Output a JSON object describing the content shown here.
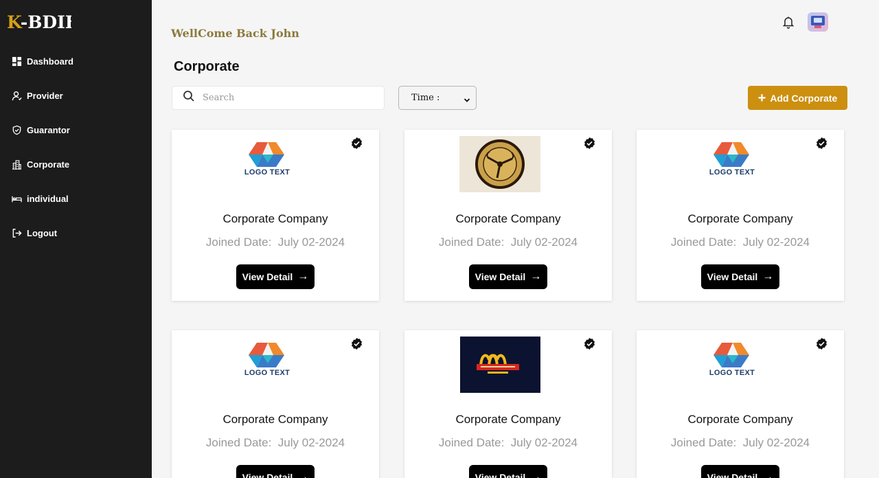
{
  "brand": {
    "k": "K",
    "rest": "-BDIF"
  },
  "sidebar": {
    "items": [
      {
        "label": "Dashboard",
        "icon": "dashboard-icon"
      },
      {
        "label": "Provider",
        "icon": "user-icon"
      },
      {
        "label": "Guarantor",
        "icon": "shield-icon"
      },
      {
        "label": "Corporate",
        "icon": "building-icon"
      },
      {
        "label": "individual",
        "icon": "bed-icon"
      },
      {
        "label": "Logout",
        "icon": "logout-icon"
      }
    ]
  },
  "header": {
    "welcome": "WellCome Back John",
    "bell_icon": "bell-icon",
    "avatar_icon": "avatar-icon"
  },
  "page": {
    "title": "Corporate"
  },
  "toolbar": {
    "search_placeholder": "Search",
    "time_label": "Time :",
    "add_label": "Add Corporate"
  },
  "colors": {
    "sidebar": "#1c1c1c",
    "accent": "#cc8f10",
    "welcome": "#8b7a3e",
    "brand_k": "#d4a017"
  },
  "cards": [
    {
      "name": "Corporate Company",
      "joined_label": "Joined Date:",
      "joined_date": "July 02-2024",
      "button": "View Detail",
      "logo": "logo-text",
      "logo_text": "LOGO TEXT"
    },
    {
      "name": "Corporate Company",
      "joined_label": "Joined Date:",
      "joined_date": "July 02-2024",
      "button": "View Detail",
      "logo": "mens-league"
    },
    {
      "name": "Corporate Company",
      "joined_label": "Joined Date:",
      "joined_date": "July 02-2024",
      "button": "View Detail",
      "logo": "logo-text",
      "logo_text": "LOGO TEXT"
    },
    {
      "name": "Corporate Company",
      "joined_label": "Joined Date:",
      "joined_date": "July 02-2024",
      "button": "View Detail",
      "logo": "logo-text",
      "logo_text": "LOGO TEXT"
    },
    {
      "name": "Corporate Company",
      "joined_label": "Joined Date:",
      "joined_date": "July 02-2024",
      "button": "View Detail",
      "logo": "mcdonalds"
    },
    {
      "name": "Corporate Company",
      "joined_label": "Joined Date:",
      "joined_date": "July 02-2024",
      "button": "View Detail",
      "logo": "logo-text",
      "logo_text": "LOGO TEXT"
    }
  ]
}
